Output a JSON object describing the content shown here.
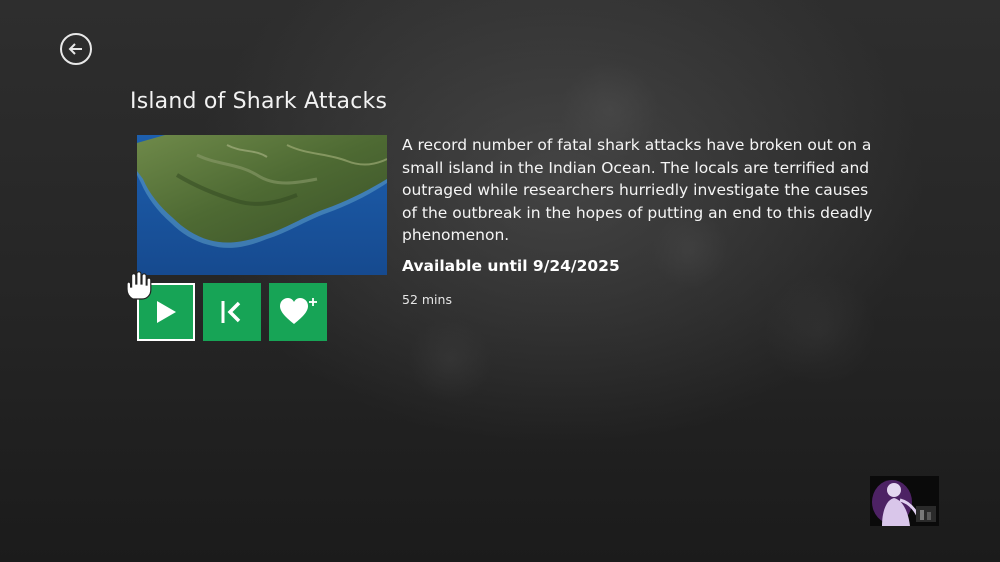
{
  "nav": {
    "back_icon": "back-arrow-circle-icon"
  },
  "show": {
    "title": "Island of Shark Attacks",
    "description": "A record number of fatal shark attacks have broken out on a small island in the Indian Ocean. The locals are terrified and outraged while researchers hurriedly investigate the causes of the outbreak in the hopes of putting an end to this deadly phenomenon.",
    "availability": "Available until 9/24/2025",
    "duration": "52 mins"
  },
  "actions": [
    {
      "name": "play",
      "icon": "play-icon"
    },
    {
      "name": "restart",
      "icon": "restart-icon"
    },
    {
      "name": "favorite",
      "icon": "heart-plus-icon"
    }
  ],
  "colors": {
    "accent": "#17a456",
    "background": "#262626",
    "text": "#f5f5f5"
  }
}
